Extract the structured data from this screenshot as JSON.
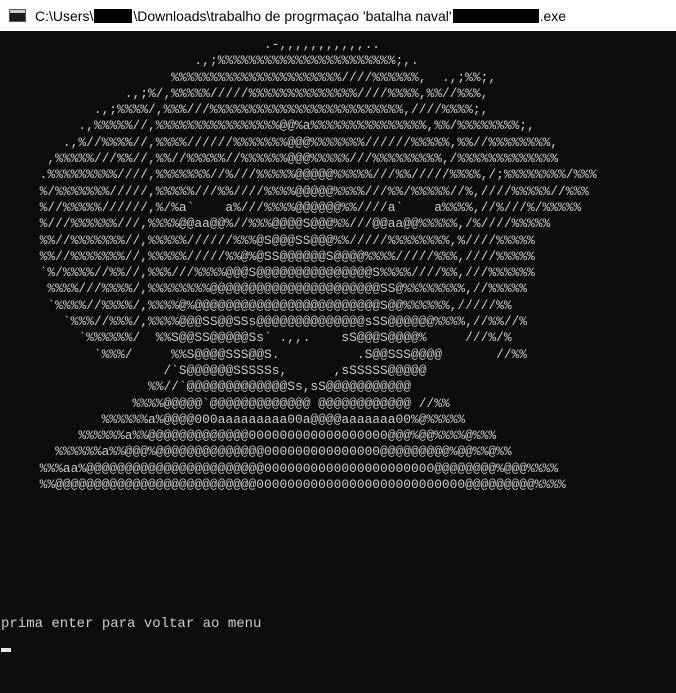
{
  "window": {
    "title_prefix": "C:\\Users\\",
    "title_middle": "\\Downloads\\trabalho de progrmaçao 'batalha naval'",
    "title_suffix": ".exe"
  },
  "console": {
    "art_lines": [
      "                                  .-,,,,,,,,,,,..",
      "                         .,;%%%%%%%%%%%%%%%%%%%%%%%;,.",
      "                      %%%%%%%%%%%%%%%%%%%%%%////%%%%%%,  .,;%%;,",
      "                .,;%/,%%%%%/////%%%%%%%%%%%%%%////%%%%,%%//%%%,",
      "            .,;%%%%/,%%%///%%%%%%%%%%%%%%%%%%%%%%%%%,////%%%%;,",
      "          .,%%%%%//,%%%%%%%%%%%%%%%%@@%a%%%%%%%%%%%%%%%,%%/%%%%%%%%;,",
      "        .,%//%%%%//,%%%%//////%%%%%%%@@@%%%%%%%//////%%%%%,%%//%%%%%%%%,",
      "      ,%%%%%///%%//,%%//%%%%%//%%%%%%@@@%%%%%///%%%%%%%%%,/%%%%%%%%%%%%%",
      "     .%%%%%%%%%////,%%%%%%%//%///%%%%%@@@@@%%%%%///%%/////%%%%,/;%%%%%%%%/%%%",
      "     %/%%%%%%%/////,%%%%%///%%////%%%%@@@@@%%%%///%%/%%%%%//%,////%%%%%//%%%",
      "     %//%%%%%//////,%/%a`    a%///%%%%@@@@@@%%////a`    a%%%%,//%///%/%%%%%",
      "     %///%%%%%%///,%%%%@@aa@@%//%%%@@@@S@@@%%///@@aa@@%%%%%,/%////%%%%%",
      "     %%//%%%%%%%//,%%%%%//////%%%@S@@@SS@@@%%/////%%%%%%%%,%////%%%%%",
      "     %%//%%%%%%%//,%%%%%/////%%@%@SS@@@@@@S@@@@%%%%/////%%%,////%%%%%",
      "     `%/%%%%//%%//,%%%///%%%%@@@S@@@@@@@@@@@@@@@S%%%%////%%,///%%%%%%",
      "      %%%%///%%%%/,%%%%%%%%@@@@@@@@@@@@@@@@@@@@@@SS@%%%%%%%%,//%%%%%",
      "      `%%%%//%%%%/,%%%%@%@@@@@@@@@@@@@@@@@@@@@@@@S@@%%%%%%,/////%%",
      "        `%%%//%%%/,%%%%@@@SS@@SSs@@@@@@@@@@@@@@sSS@@@@@@%%%%,//%%//%",
      "          `%%%%%%/  %%S@@SS@@@@@Ss` .,,.    sS@@@S@@@@%     ///%/%",
      "            `%%%/     %%S@@@@SSS@@S.          .S@@SSS@@@@       //%%",
      "                     /`S@@@@@@SSSSSs,      ,sSSSSS@@@@@",
      "                   %%//`@@@@@@@@@@@@@Ss,sS@@@@@@@@@@@",
      "                 %%%%@@@@@`@@@@@@@@@@@@@ @@@@@@@@@@@@ //%%",
      "             %%%%%%a%@@@@000aaaaaaaaa00a@@@@aaaaaaa00%@%%%%%",
      "          %%%%%%a%%@@@@@@@@@@@@@000000000000000000@@@%@@%%%%@%%%",
      "       %%%%%%a%%@@@%@@@@@@@@@@@@@@000000000000000@@@@@@@@@%@@%%@%%",
      "     %%%aa%@@@@@@@@@@@@@@@@@@@@@@@0000000000000000000000@@@@@@@@%@@@%%%%",
      "     %%@@@@@@@@@@@@@@@@@@@@@@@@@@000000000000000000000000000@@@@@@@@@%%%%"
    ],
    "prompt_text": "prima enter para voltar ao menu"
  },
  "colors": {
    "background": "#0c0c0c",
    "text": "#cccccc",
    "titlebar": "#ffffff"
  }
}
